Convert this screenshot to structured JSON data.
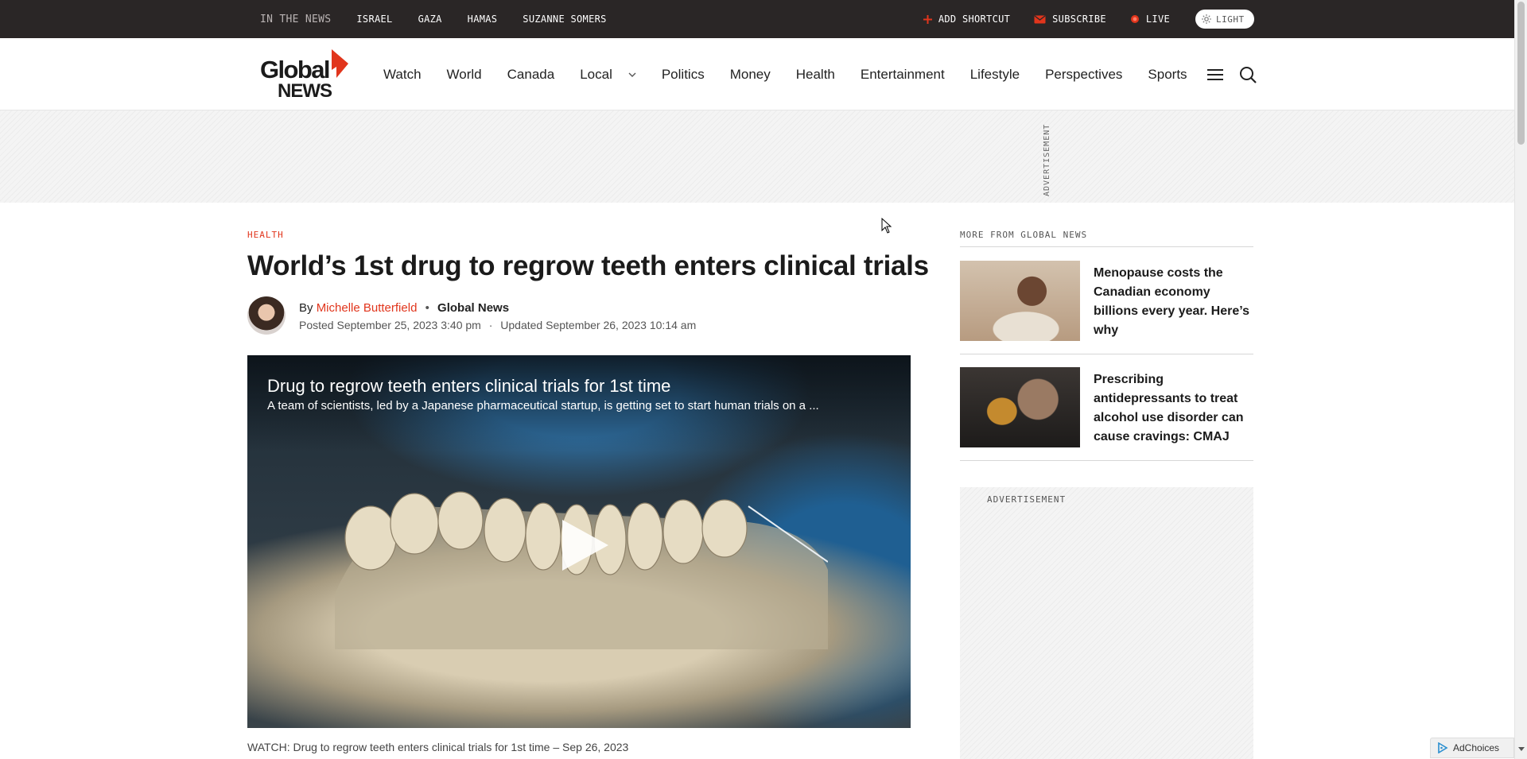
{
  "topbar": {
    "in_the_news": "IN THE NEWS",
    "tags": [
      "ISRAEL",
      "GAZA",
      "HAMAS",
      "SUZANNE SOMERS"
    ],
    "add_shortcut": "ADD SHORTCUT",
    "subscribe": "SUBSCRIBE",
    "live": "LIVE",
    "theme_toggle": "LIGHT"
  },
  "logo": {
    "line1": "Global",
    "line2": "NEWS"
  },
  "nav": {
    "items": [
      "Watch",
      "World",
      "Canada",
      "Local",
      "Politics",
      "Money",
      "Health",
      "Entertainment",
      "Lifestyle",
      "Perspectives",
      "Sports"
    ]
  },
  "ad_banner_label": "ADVERTISEMENT",
  "article": {
    "category": "HEALTH",
    "headline": "World’s 1st drug to regrow teeth enters clinical trials",
    "by_prefix": "By",
    "author": "Michelle Butterfield",
    "separator": "•",
    "organization": "Global News",
    "posted": "Posted September 25, 2023 3:40 pm",
    "dates_sep": "·",
    "updated": "Updated September 26, 2023 10:14 am",
    "video": {
      "title": "Drug to regrow teeth enters clinical trials for 1st time",
      "description": "A team of scientists, led by a Japanese pharmaceutical startup, is getting set to start human trials on a ..."
    },
    "caption": "WATCH: Drug to regrow teeth enters clinical trials for 1st time – Sep 26, 2023"
  },
  "sidebar": {
    "title": "MORE FROM GLOBAL NEWS",
    "stories": [
      {
        "title": "Menopause costs the Canadian economy billions every year. Here’s why"
      },
      {
        "title": "Prescribing antidepressants to treat alcohol use disorder can cause cravings: CMAJ"
      }
    ],
    "ad_label": "ADVERTISEMENT"
  },
  "adchoices": "AdChoices",
  "colors": {
    "accent": "#e1351c",
    "topbar": "#2a2626"
  }
}
